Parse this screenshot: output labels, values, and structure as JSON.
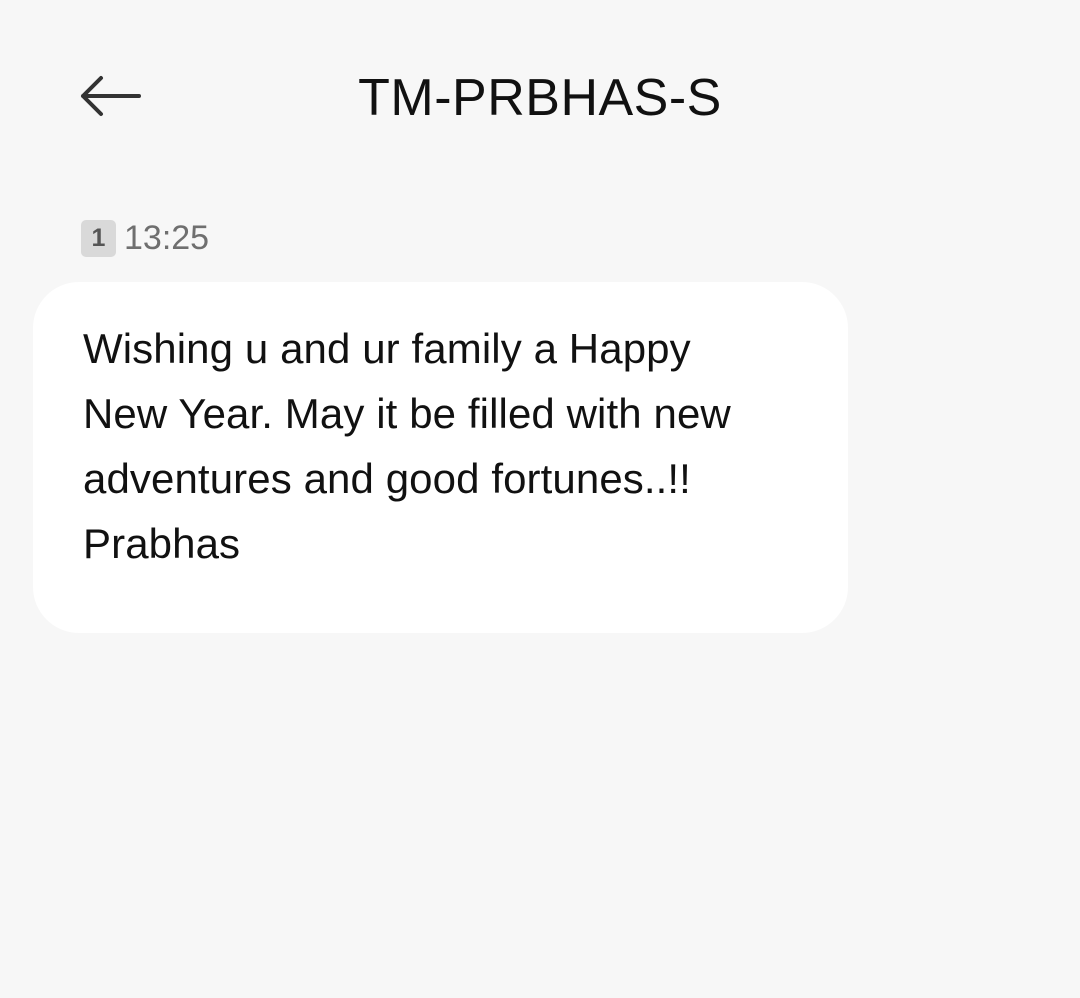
{
  "header": {
    "title": "TM-PRBHAS-S",
    "back_icon": "arrow-left-icon"
  },
  "message": {
    "sim_slot": "1",
    "time": "13:25",
    "body": "Wishing u and ur family a Happy\nNew Year. May it be filled with new\nadventures and good fortunes..!!\nPrabhas"
  },
  "colors": {
    "background": "#f7f7f7",
    "bubble": "#ffffff",
    "sim_badge": "#d9d9d9",
    "timestamp": "#6f6f6f",
    "text": "#111111"
  }
}
